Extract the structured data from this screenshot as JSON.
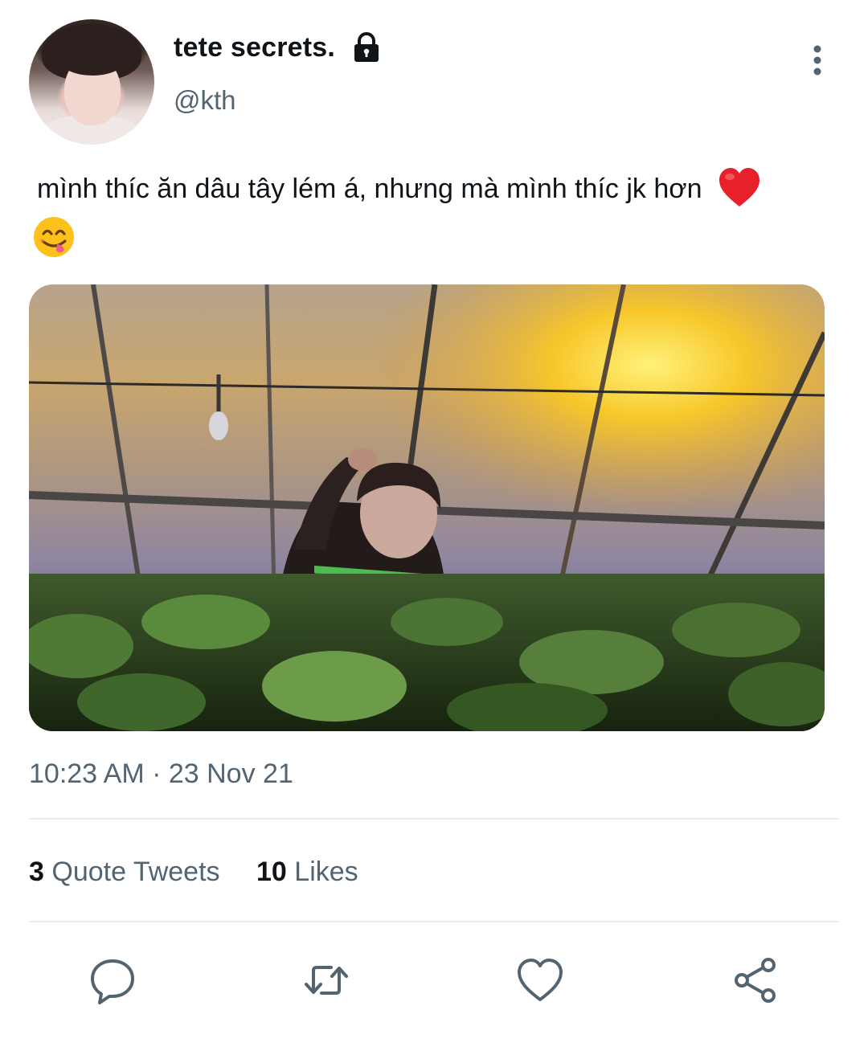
{
  "user": {
    "display_name": "tete secrets.",
    "handle": "@kth",
    "protected_icon": "lock-icon"
  },
  "tweet": {
    "text": "mình thíc ăn dâu tây lém á, nhưng mà mình thíc jk hơn",
    "emojis": [
      "red-heart-emoji",
      "face-savoring-food-emoji"
    ],
    "timestamp": "10:23 AM · 23 Nov 21"
  },
  "stats": {
    "quote_tweets_count": "3",
    "quote_tweets_label": "Quote Tweets",
    "likes_count": "10",
    "likes_label": "Likes"
  },
  "actions": [
    "reply-icon",
    "retweet-icon",
    "like-icon",
    "share-icon"
  ],
  "colors": {
    "text_primary": "#0f1419",
    "text_secondary": "#536471",
    "icon": "#536471",
    "divider": "#e6ecf0"
  }
}
